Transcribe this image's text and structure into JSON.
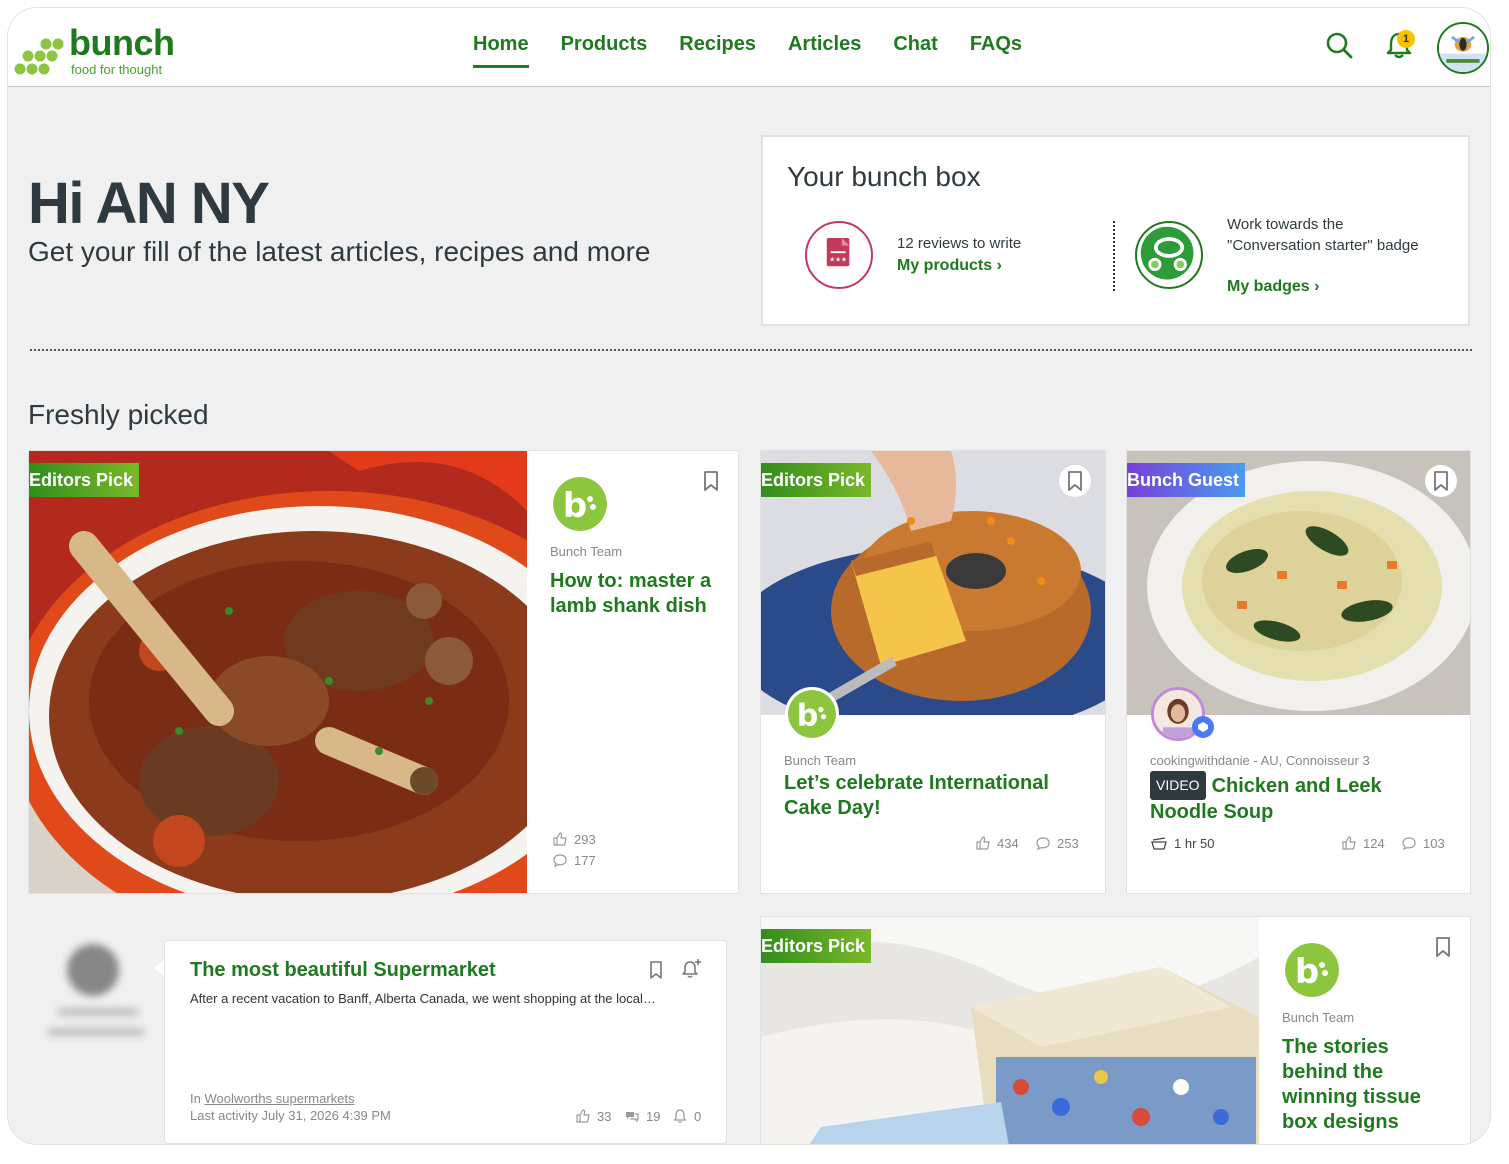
{
  "header": {
    "logo": {
      "word": "bunch",
      "tagline": "food for thought"
    },
    "nav": [
      {
        "label": "Home",
        "active": true
      },
      {
        "label": "Products"
      },
      {
        "label": "Recipes"
      },
      {
        "label": "Articles"
      },
      {
        "label": "Chat"
      },
      {
        "label": "FAQs"
      }
    ],
    "notification_count": "1",
    "icons": {
      "search": "search-icon",
      "bell": "bell-icon",
      "avatar": "user-avatar"
    }
  },
  "greeting": {
    "title": "Hi AN NY",
    "subtitle": "Get your fill of the latest articles, recipes and more"
  },
  "bunch_box": {
    "title": "Your bunch box",
    "reviews": {
      "text": "12 reviews to write",
      "link": "My products"
    },
    "badge": {
      "text": "Work towards the \"Conversation starter\" badge",
      "link": "My badges"
    }
  },
  "section": {
    "title": "Freshly picked"
  },
  "cards": [
    {
      "ribbon": "Editors Pick",
      "author": "Bunch Team",
      "title": "How to: master a lamb shank dish",
      "likes": "293",
      "comments": "177"
    },
    {
      "ribbon": "Editors Pick",
      "author": "Bunch Team",
      "title": "Let’s celebrate International Cake Day!",
      "likes": "434",
      "comments": "253"
    },
    {
      "ribbon": "Bunch Guest",
      "author": "cookingwithdanie - AU, Connoisseur 3",
      "badge": "VIDEO",
      "title": "Chicken and Leek Noodle Soup",
      "time": "1 hr 50",
      "likes": "124",
      "comments": "103"
    }
  ],
  "discussion": {
    "title": "The most beautiful Supermarket",
    "excerpt": "After a recent vacation to Banff, Alberta Canada, we went shopping at the local…",
    "in_prefix": "In ",
    "group": "Woolworths supermarkets",
    "last_activity": "Last activity July 31, 2026 4:39 PM",
    "likes": "33",
    "replies": "19",
    "followers": "0"
  },
  "feature_card": {
    "ribbon": "Editors Pick",
    "author": "Bunch Team",
    "title": "The stories behind the winning tissue box designs"
  },
  "colors": {
    "brand_green": "#1f7a1f",
    "accent_yellow": "#f5c400",
    "review_red": "#c23a5a",
    "guest_purple": "#7a3cd6"
  }
}
